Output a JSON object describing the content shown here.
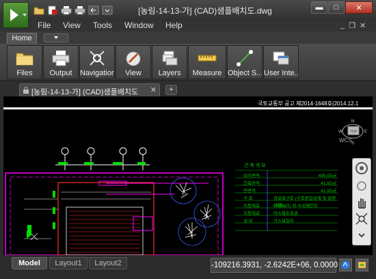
{
  "app": {
    "title": "[농림-14-13-가] (CAD)샘플배치도.dwg"
  },
  "menu": {
    "file": "File",
    "view": "View",
    "tools": "Tools",
    "window": "Window",
    "help": "Help"
  },
  "ribbon": {
    "tab": "Home",
    "buttons": [
      {
        "label": "Files",
        "icon": "folder-icon"
      },
      {
        "label": "Output",
        "icon": "printer-icon"
      },
      {
        "label": "Navigation",
        "icon": "navigation-icon"
      },
      {
        "label": "View",
        "icon": "view-icon"
      },
      {
        "label": "Layers",
        "icon": "layers-icon"
      },
      {
        "label": "Measure",
        "icon": "ruler-icon"
      },
      {
        "label": "Object S...",
        "icon": "object-snap-icon"
      },
      {
        "label": "User Inte...",
        "icon": "user-interface-icon"
      }
    ]
  },
  "document_tab": {
    "label": "[농림-14-13-가] (CAD)샘플배치도",
    "close": "✕",
    "new": "+"
  },
  "drawing": {
    "header": "국토교통부 공고 제2014-1648호(2014.12.1",
    "viewcube": {
      "top": "TOP",
      "north": "N",
      "south": "S",
      "east": "E",
      "west": "W"
    },
    "wcs": "WCS",
    "info_title": "건 축 개 요",
    "info_rows": [
      {
        "key": "대지면적",
        "value": "495.00㎡"
      },
      {
        "key": "건축면적",
        "value": "41.92㎡"
      },
      {
        "key": "연면적",
        "value": "41.92㎡"
      },
      {
        "key": "구 조",
        "value": "경골목구조 (구조용집성재 및 합판사용)"
      },
      {
        "key": "지붕재료",
        "value": "OSB보드 위 수성페인트"
      },
      {
        "key": "지붕재료",
        "value": "아스팔트슁글"
      },
      {
        "key": "설 비",
        "value": "가스보일러"
      }
    ]
  },
  "layout_tabs": [
    "Model",
    "Layout1",
    "Layout2"
  ],
  "status": {
    "coordinates": "-109216.3931, -2.6242E+06, 0.0000"
  },
  "colors": {
    "accent": "#2d6b1a",
    "drawing_bg": "#000000",
    "cad_red": "#ff3030",
    "cad_green": "#00cc00",
    "cad_magenta": "#ff00ff"
  }
}
